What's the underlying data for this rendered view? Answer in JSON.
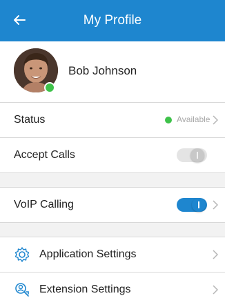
{
  "header": {
    "title": "My Profile",
    "back_icon": "arrow-left-icon"
  },
  "profile": {
    "name": "Bob Johnson",
    "presence_color": "#3ec24a"
  },
  "rows": {
    "status": {
      "label": "Status",
      "value": "Available"
    },
    "accept_calls": {
      "label": "Accept Calls",
      "enabled": false
    },
    "voip": {
      "label": "VoIP Calling",
      "enabled": true
    },
    "app_settings": {
      "label": "Application Settings",
      "icon": "gear-icon"
    },
    "ext_settings": {
      "label": "Extension Settings",
      "icon": "extension-person-icon"
    }
  },
  "colors": {
    "accent": "#1e86cf",
    "available": "#3ec24a"
  }
}
